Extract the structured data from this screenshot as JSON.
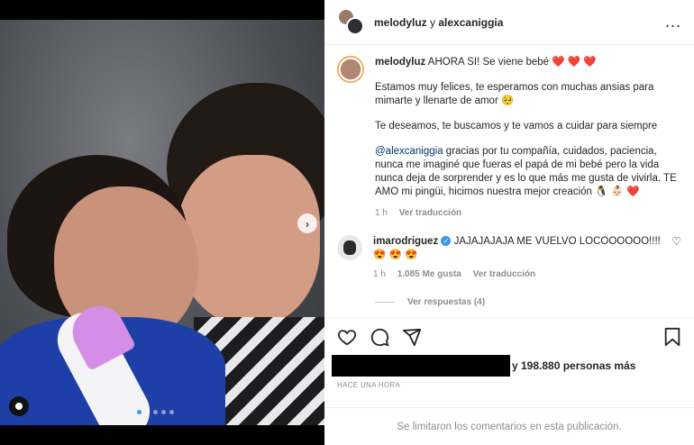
{
  "header": {
    "user1": "melodyluz",
    "connector": "y",
    "user2": "alexcaniggia",
    "more": "..."
  },
  "caption": {
    "username": "melodyluz",
    "line1": "AHORA SI! Se viene bebé ❤️ ❤️ ❤️",
    "para1": "Estamos muy felices, te esperamos con muchas ansias para mimarte y llenarte de amor 🥺",
    "para2": "Te deseamos, te buscamos y te vamos a cuidar para siempre",
    "mention": "@alexcaniggia",
    "para3": " gracias por tu compañía, cuidados, paciencia, nunca me imaginé que fueras el papá de mi bebé pero la vida nunca deja de sorprender y es lo que más me gusta de vivirla. TE AMO mi pingüi, hicimos nuestra mejor creación 🐧 👶🏻 ❤️",
    "time": "1 h",
    "translate": "Ver traducción"
  },
  "comment": {
    "username": "imarodriguez",
    "verified": "✓",
    "text": "JAJAJAJAJA ME VUELVO LOCOOOOOO!!!! 😍 😍 😍",
    "time": "1 h",
    "likes": "1.085 Me gusta",
    "translate": "Ver traducción",
    "replies": "Ver respuestas (4)"
  },
  "likes": {
    "text": "y 198.880 personas más"
  },
  "post_time": "HACE UNA HORA",
  "comments_limited": "Se limitaron los comentarios en esta publicación.",
  "icons": {
    "like": "heart-icon",
    "comment": "comment-icon",
    "share": "share-icon",
    "save": "bookmark-icon",
    "next": "chevron-right-icon",
    "tag": "user-tag-icon"
  },
  "carousel": {
    "count": 5,
    "active": 1
  },
  "colors": {
    "accent": "#3897f0",
    "text": "#262626",
    "muted": "#8e8e8e",
    "mention": "#00376b",
    "heart": "#ed4956"
  }
}
